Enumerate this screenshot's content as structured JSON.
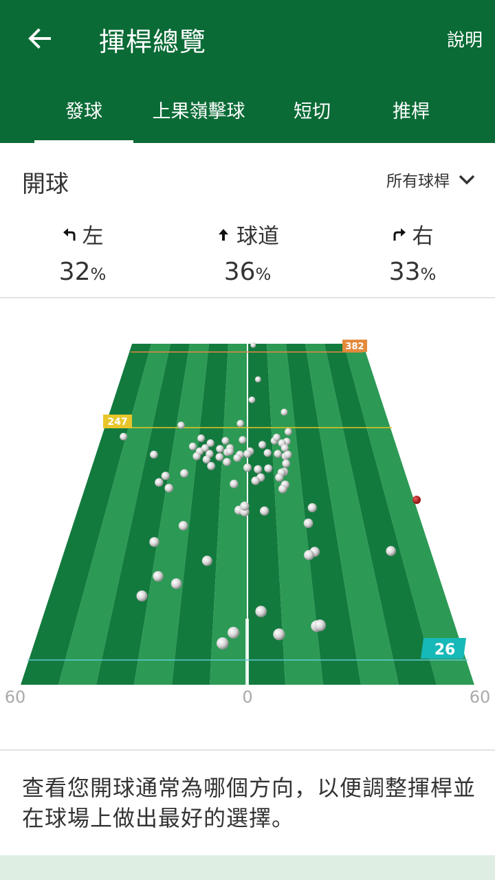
{
  "header": {
    "title": "揮桿總覽",
    "help_label": "說明"
  },
  "tabs": [
    {
      "label": "發球",
      "active": true
    },
    {
      "label": "上果嶺擊球",
      "active": false
    },
    {
      "label": "短切",
      "active": false
    },
    {
      "label": "推桿",
      "active": false
    }
  ],
  "section": {
    "title": "開球",
    "club_filter": "所有球桿"
  },
  "stats": {
    "left": {
      "label": "左",
      "value": "32",
      "unit": "%"
    },
    "fairway": {
      "label": "球道",
      "value": "36",
      "unit": "%"
    },
    "right": {
      "label": "右",
      "value": "33",
      "unit": "%"
    }
  },
  "field": {
    "markers": {
      "far": "382",
      "mid": "247",
      "near": "26"
    },
    "axis": {
      "left": "60",
      "center": "0",
      "right": "60"
    }
  },
  "chart_data": {
    "type": "scatter",
    "x_range": [
      -60,
      60
    ],
    "y_range": [
      0,
      382
    ],
    "reference_lines": [
      {
        "label": "382",
        "y": 382
      },
      {
        "label": "247",
        "y": 247
      },
      {
        "label": "26",
        "y": 26
      }
    ],
    "series": [
      {
        "values": [
          [
            3,
            382
          ],
          [
            5,
            340
          ],
          [
            2,
            315
          ],
          [
            16,
            300
          ],
          [
            -51,
            270
          ],
          [
            -28,
            284
          ],
          [
            -3,
            286
          ],
          [
            6,
            260
          ],
          [
            -8,
            251
          ],
          [
            1,
            252
          ],
          [
            -11,
            255
          ],
          [
            -37,
            248
          ],
          [
            -19,
            268
          ],
          [
            -2,
            266
          ],
          [
            -22,
            258
          ],
          [
            -19,
            252
          ],
          [
            -20,
            246
          ],
          [
            -15,
            249
          ],
          [
            -7,
            256
          ],
          [
            -9,
            265
          ],
          [
            -17,
            256
          ],
          [
            -15,
            262
          ],
          [
            -16,
            242
          ],
          [
            -14,
            234
          ],
          [
            -8,
            239
          ],
          [
            -24,
            225
          ],
          [
            -7,
            252
          ],
          [
            -3,
            248
          ],
          [
            -4,
            244
          ],
          [
            -11,
            245
          ],
          [
            0,
            249
          ],
          [
            0,
            232
          ],
          [
            -5,
            212
          ],
          [
            -3,
            180
          ],
          [
            -1,
            178
          ],
          [
            -31,
            222
          ],
          [
            4,
            230
          ],
          [
            8,
            231
          ],
          [
            5,
            220
          ],
          [
            3,
            216
          ],
          [
            -33,
            214
          ],
          [
            -29,
            207
          ],
          [
            8,
            250
          ],
          [
            12,
            249
          ],
          [
            15,
            246
          ],
          [
            11,
            265
          ],
          [
            12,
            269
          ],
          [
            16,
            264
          ],
          [
            14,
            262
          ],
          [
            15,
            256
          ],
          [
            16,
            248
          ],
          [
            15,
            237
          ],
          [
            14,
            227
          ],
          [
            13,
            226
          ],
          [
            12,
            220
          ],
          [
            14,
            211
          ],
          [
            13,
            206
          ],
          [
            -1,
            185
          ],
          [
            6,
            179
          ],
          [
            23,
            183
          ],
          [
            21,
            164
          ],
          [
            22,
            129
          ],
          [
            -13,
            118
          ],
          [
            -28,
            99
          ],
          [
            -22,
            161
          ],
          [
            -31,
            141
          ],
          [
            20,
            125
          ],
          [
            47,
            130
          ],
          [
            -33,
            214
          ],
          [
            17,
            276
          ],
          [
            4,
            56
          ],
          [
            9,
            28
          ],
          [
            20,
            38
          ],
          [
            21,
            39
          ],
          [
            -4,
            30
          ],
          [
            -7,
            17
          ],
          [
            -32,
            75
          ],
          [
            -22,
            90
          ]
        ]
      }
    ]
  },
  "description": "查看您開球通常為哪個方向，以便調整揮桿並在球場上做出最好的選擇。",
  "colors": {
    "primary": "#0b6b36",
    "field_dark": "#137a3e",
    "field_light": "#2c9a55",
    "marker_far": "#e38a3c",
    "marker_mid": "#e8c52a",
    "marker_near": "#17b8b8",
    "red_ball": "#b51c1c"
  },
  "icons": {
    "back": "arrow-left-icon",
    "dropdown": "chevron-down-icon",
    "left": "turn-left-icon",
    "fairway": "arrow-up-icon",
    "right": "turn-right-icon"
  }
}
